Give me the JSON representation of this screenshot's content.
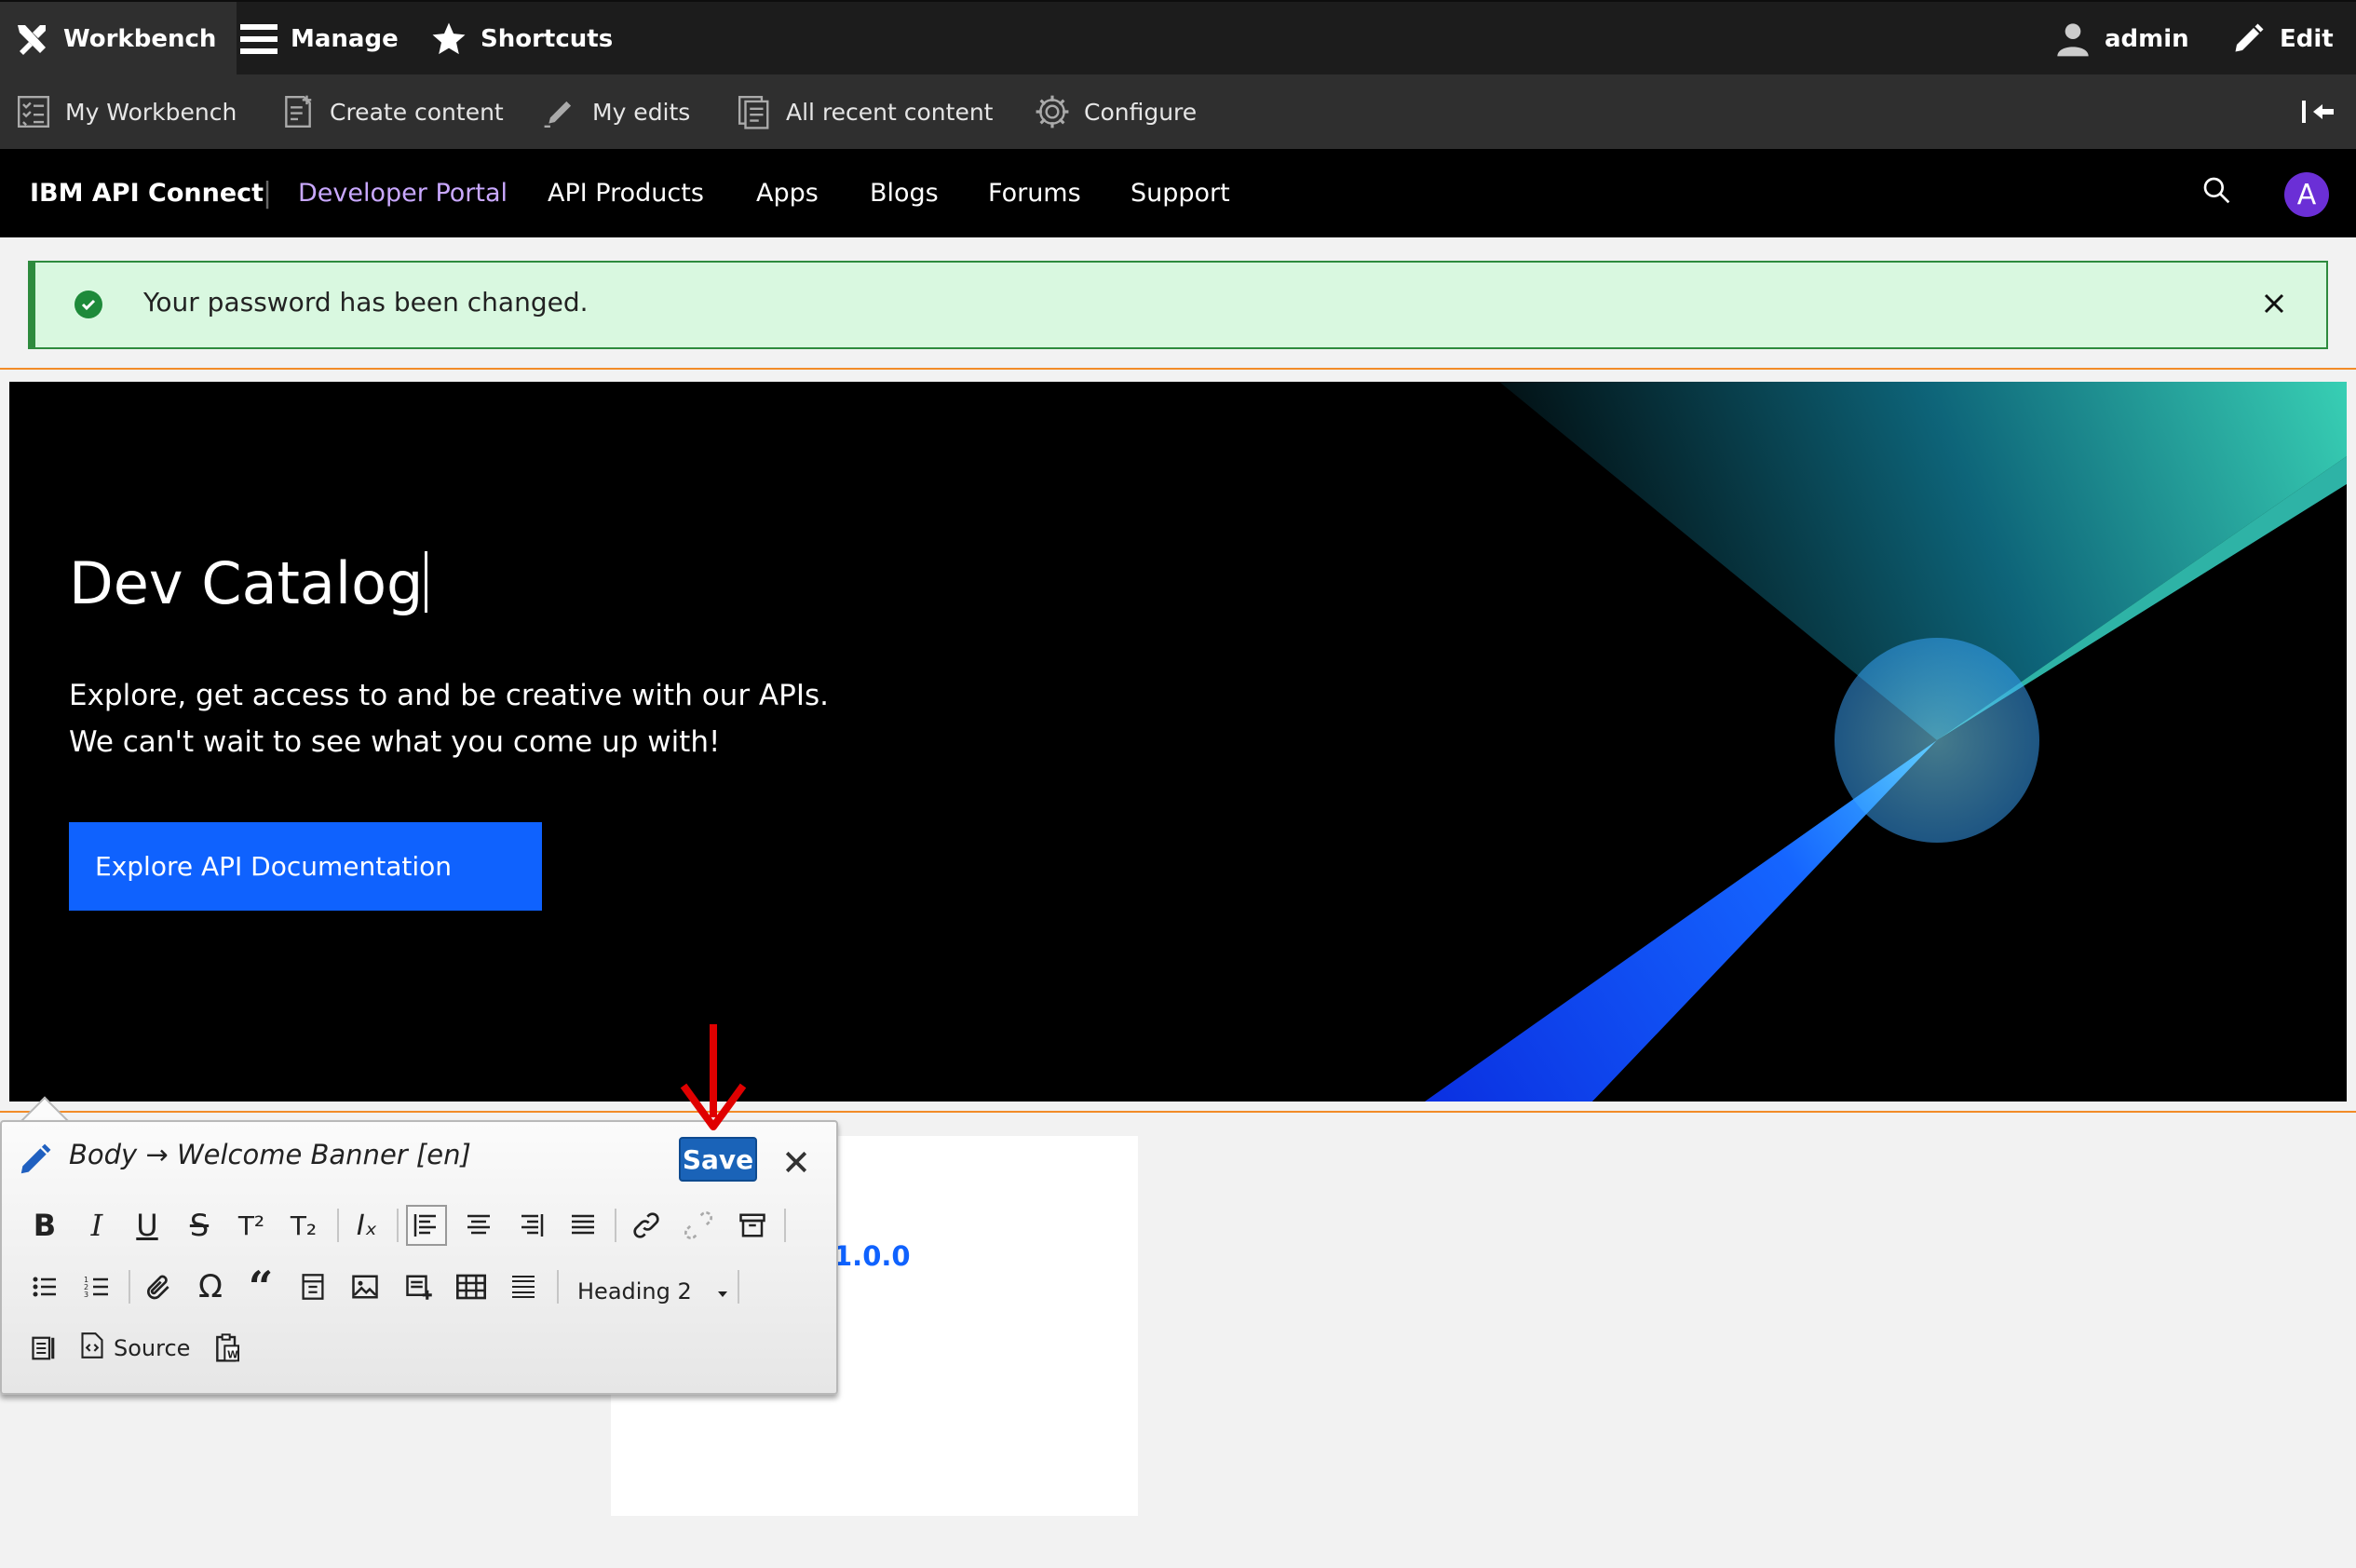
{
  "toolbar": {
    "workbench": "Workbench",
    "manage": "Manage",
    "shortcuts": "Shortcuts",
    "user": "admin",
    "edit": "Edit"
  },
  "tray": {
    "my_workbench": "My Workbench",
    "create_content": "Create content",
    "my_edits": "My edits",
    "all_recent": "All recent content",
    "configure": "Configure"
  },
  "portal_nav": {
    "brand": "IBM API Connect",
    "separator": "|",
    "portal": "Developer Portal",
    "items": [
      "API Products",
      "Apps",
      "Blogs",
      "Forums",
      "Support"
    ],
    "avatar_letter": "A"
  },
  "message": {
    "text": "Your password has been changed."
  },
  "hero": {
    "title": "Dev Catalog",
    "desc_line1": "Explore, get access to and be creative with our APIs.",
    "desc_line2": "We can't wait to see what you come up with!",
    "button": "Explore API Documentation"
  },
  "card": {
    "partial_link": "1.0.0"
  },
  "editor": {
    "title": "Body → Welcome Banner [en]",
    "save": "Save",
    "format_select": "Heading 2",
    "source": "Source"
  },
  "colors": {
    "toolbar_bg": "#1c1c1c",
    "tray_bg": "#2f2f2f",
    "portal_bg": "#000000",
    "portal_active": "#c9a8ff",
    "message_bg": "#d9f8e0",
    "message_border": "#2e8b3e",
    "hero_button": "#0f62fe",
    "save_button": "#1a63b8",
    "annotation_arrow": "#e00000",
    "outline": "#f28c28"
  }
}
